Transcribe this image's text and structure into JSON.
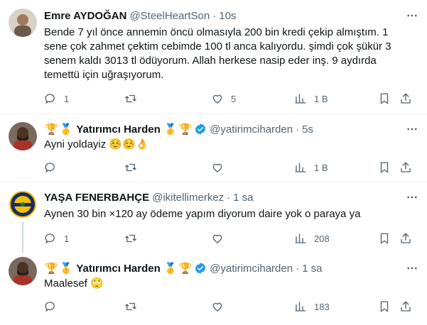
{
  "tweets": [
    {
      "name": "Emre AYDOĞAN",
      "handle": "@SteelHeartSon",
      "time": "10s",
      "text": "Bende 7 yıl önce annemin öncü olmasıyla 200 bin kredi çekip almıştım. 1\nsene çok zahmet çektim cebimde 100 tl anca kalıyordu. şimdi çok şükür 3\nsenem kaldı 3013 tl ödüyorum. Allah herkese nasip eder inş. 9 aydırda\ntemettü  için uğraşıyorum.",
      "replies": "1",
      "retweets": "",
      "likes": "5",
      "views": "1 B"
    },
    {
      "name": "Yatırımcı Harden",
      "handle": "@yatirimciharden",
      "time": "5s",
      "text": "Ayni yoldayiz ☺️☺️👌",
      "replies": "",
      "retweets": "",
      "likes": "",
      "views": "1 B"
    },
    {
      "name": "YAŞA FENERBAHÇE",
      "handle": "@ikitellimerkez",
      "time": "1 sa",
      "text": "Aynen 30 bin ×120 ay ödeme yapım diyorum daire yok o paraya ya",
      "replies": "1",
      "retweets": "",
      "likes": "",
      "views": "208"
    },
    {
      "name": "Yatırımcı Harden",
      "handle": "@yatirimciharden",
      "time": "1 sa",
      "text": "Maalesef 🙄",
      "replies": "",
      "retweets": "",
      "likes": "",
      "views": "183"
    }
  ],
  "badges": {
    "trophy": "🏆",
    "medal": "🥇"
  },
  "colors": {
    "text": "#0f1419",
    "secondary": "#536471",
    "verified": "#1d9bf0",
    "line": "#cfd9de"
  }
}
